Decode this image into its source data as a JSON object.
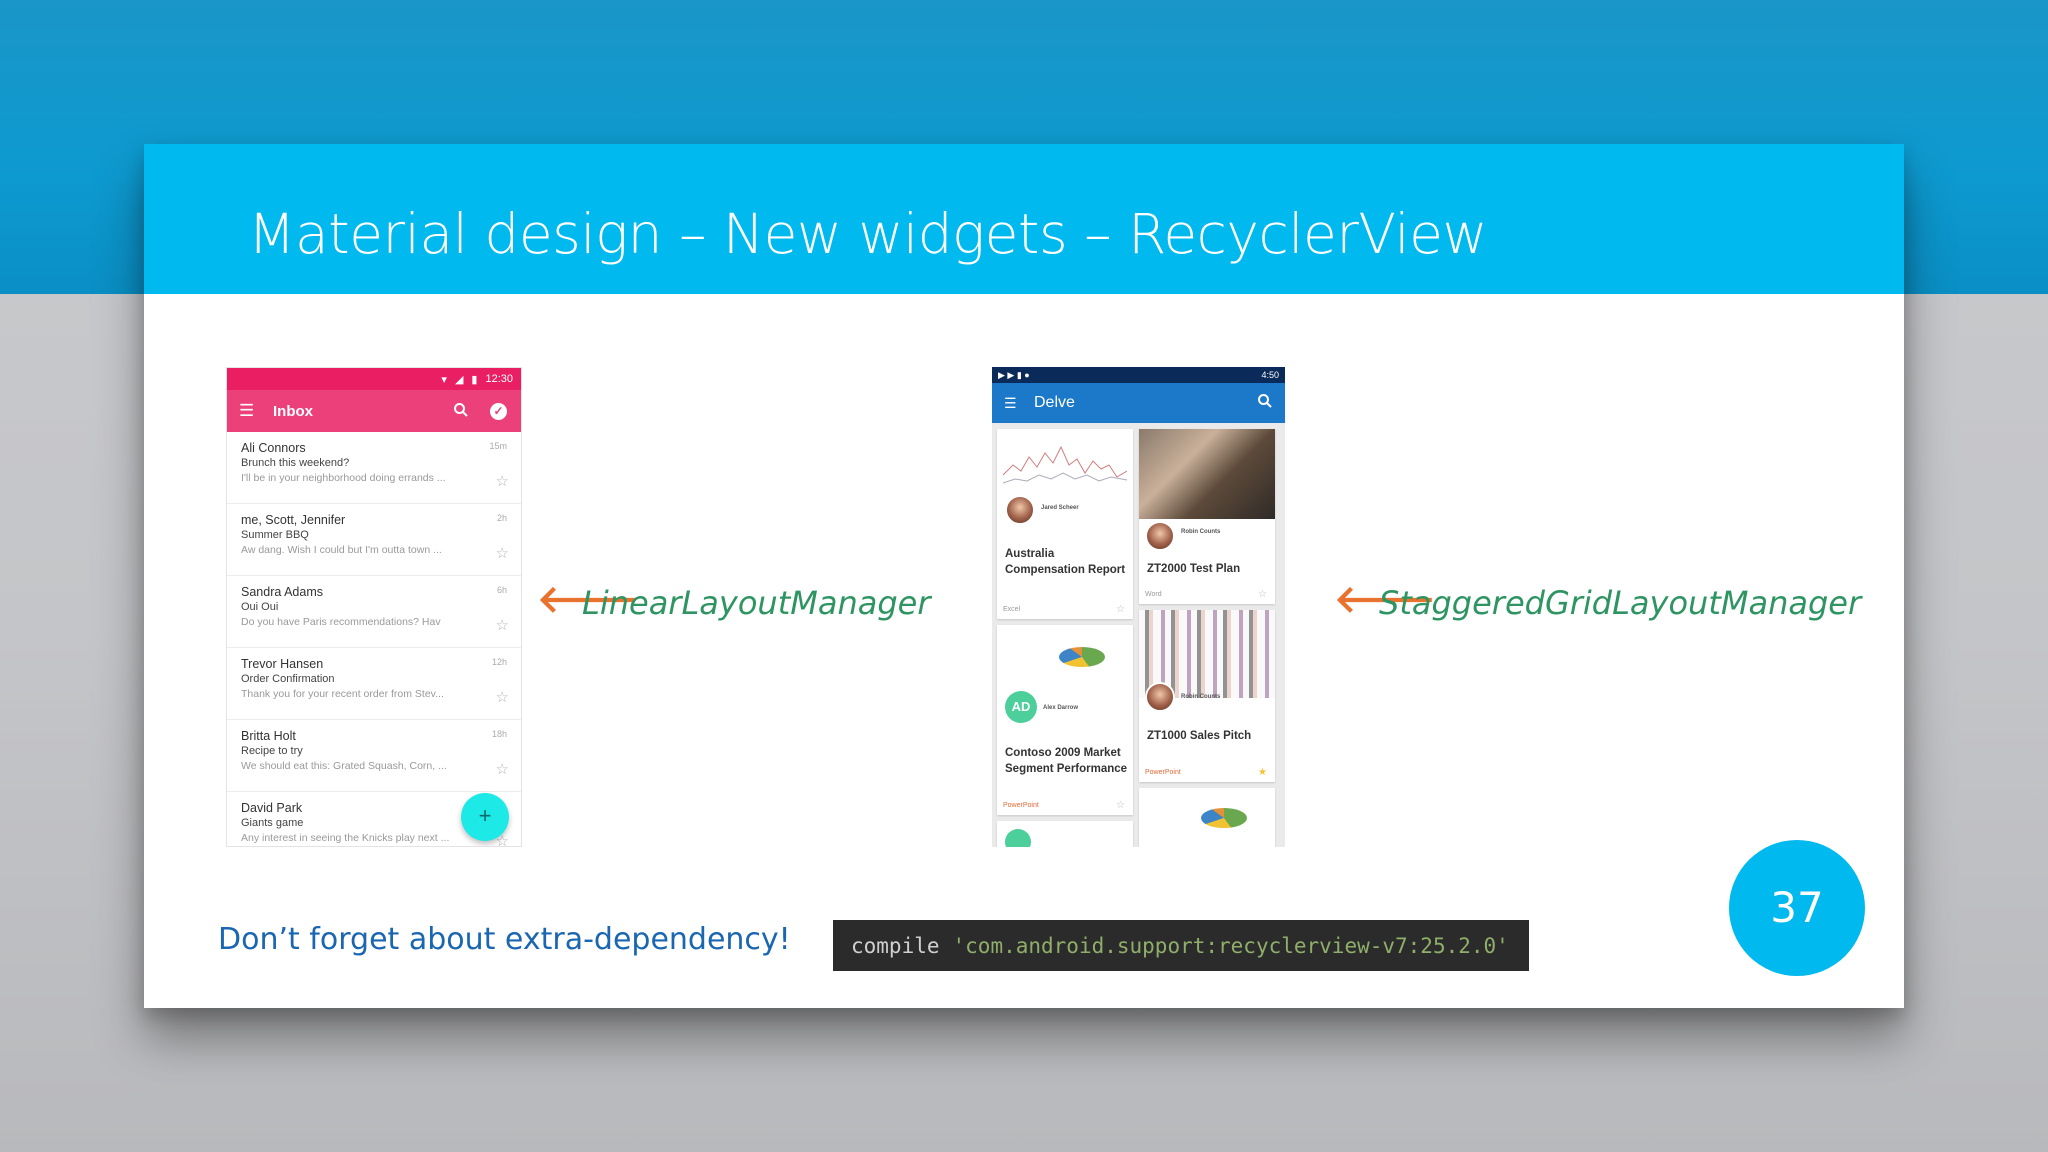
{
  "slide": {
    "title": "Material design – New widgets – RecyclerView",
    "reminder": "Don’t forget about extra-dependency!",
    "code_keyword": "compile",
    "code_string": "'com.android.support:recyclerview-v7:25.2.0'",
    "page_number": "37",
    "colors": {
      "header": "#00b9ef",
      "label": "#2e9462",
      "arrow": "#e8722e",
      "reminder": "#1a66b0"
    }
  },
  "linear": {
    "label": "LinearLayoutManager",
    "arrow_icon": "arrow-left-icon",
    "status_time": "12:30",
    "toolbar_title": "Inbox",
    "fab_icon": "+",
    "emails": [
      {
        "from": "Ali Connors",
        "subject": "Brunch this weekend?",
        "preview": "I'll be in your neighborhood doing errands ...",
        "time": "15m"
      },
      {
        "from": "me, Scott, Jennifer",
        "subject": "Summer BBQ",
        "preview": "Aw dang. Wish I could but I'm outta town ...",
        "time": "2h"
      },
      {
        "from": "Sandra Adams",
        "subject": "Oui Oui",
        "preview": "Do you have Paris recommendations? Hav",
        "time": "6h"
      },
      {
        "from": "Trevor Hansen",
        "subject": "Order Confirmation",
        "preview": "Thank you for your recent order from Stev...",
        "time": "12h"
      },
      {
        "from": "Britta Holt",
        "subject": "Recipe to try",
        "preview": "We should eat this: Grated Squash, Corn, ...",
        "time": "18h"
      },
      {
        "from": "David Park",
        "subject": "Giants game",
        "preview": "Any interest in seeing the Knicks play next ...",
        "time": ""
      }
    ]
  },
  "staggered": {
    "label": "StaggeredGridLayoutManager",
    "arrow_icon": "arrow-left-icon",
    "status_time": "4:50",
    "toolbar_title": "Delve",
    "cards": [
      {
        "title": "Australia Compensation Report",
        "person": "Jared Scheer",
        "foot": "Excel"
      },
      {
        "title": "ZT2000 Test Plan",
        "person": "Robin Counts",
        "foot": "Word"
      },
      {
        "title": "Contoso 2009 Market Segment Performance",
        "person": "Alex Darrow",
        "initials": "AD",
        "foot": "PowerPoint"
      },
      {
        "title": "ZT1000 Sales Pitch",
        "person": "Robin Counts",
        "foot": "PowerPoint"
      }
    ]
  }
}
